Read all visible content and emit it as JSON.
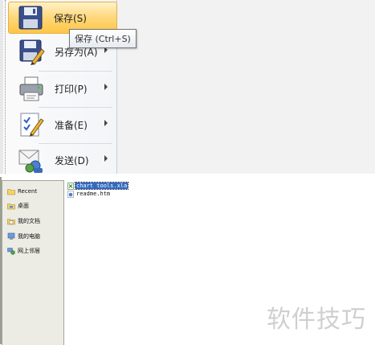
{
  "menu": {
    "items": [
      {
        "label": "保存(S)",
        "icon": "floppy-disk-icon",
        "highlighted": true
      },
      {
        "label": "另存为(A)",
        "icon": "save-as-icon"
      },
      {
        "label": "打印(P)",
        "icon": "printer-icon"
      },
      {
        "label": "准备(E)",
        "icon": "prepare-document-icon"
      },
      {
        "label": "发送(D)",
        "icon": "send-mail-icon"
      }
    ],
    "tooltip": "保存 (Ctrl+S)"
  },
  "dialog": {
    "places": [
      {
        "label": "Recent",
        "icon": "recent-folder-icon"
      },
      {
        "label": "桌面",
        "icon": "desktop-icon"
      },
      {
        "label": "我的文档",
        "icon": "my-documents-icon"
      },
      {
        "label": "我的电脑",
        "icon": "my-computer-icon"
      },
      {
        "label": "网上邻居",
        "icon": "network-places-icon"
      }
    ],
    "files": [
      {
        "name": "chart tools.xla",
        "selected": true,
        "icon": "excel-addin-file-icon"
      },
      {
        "name": "readme.htm",
        "selected": false,
        "icon": "html-file-icon"
      }
    ]
  },
  "watermark": "软件技巧",
  "colors": {
    "highlight": "#ffd77a",
    "selection": "#316ac5"
  }
}
